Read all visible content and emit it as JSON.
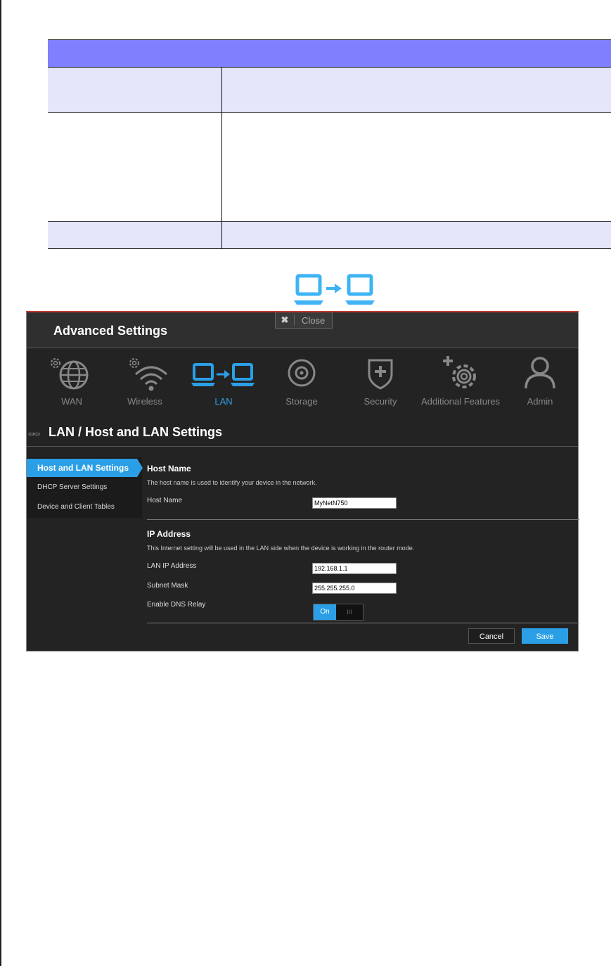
{
  "app": {
    "title": "Advanced Settings",
    "close_label": "Close",
    "close_x": "✖"
  },
  "nav": {
    "items": [
      {
        "label": "WAN",
        "icon": "globe-gear-icon"
      },
      {
        "label": "Wireless",
        "icon": "wifi-gear-icon"
      },
      {
        "label": "LAN",
        "icon": "lan-computers-icon",
        "active": true
      },
      {
        "label": "Storage",
        "icon": "storage-disc-icon"
      },
      {
        "label": "Security",
        "icon": "shield-icon"
      },
      {
        "label": "Additional Features",
        "icon": "add-gear-icon"
      },
      {
        "label": "Admin",
        "icon": "user-icon"
      }
    ]
  },
  "page": {
    "title": "LAN / Host and LAN Settings",
    "title_icon": "▭▭"
  },
  "sidebar": {
    "items": [
      {
        "label": "Host and LAN Settings",
        "active": true
      },
      {
        "label": "DHCP Server Settings"
      },
      {
        "label": "Device and Client Tables"
      }
    ]
  },
  "host_name": {
    "title": "Host Name",
    "desc": "The host name is used to identify your device in the network.",
    "label": "Host Name",
    "value": "MyNetN750"
  },
  "ip_address": {
    "title": "IP Address",
    "desc": "This Internet setting will be used in the LAN side when the device is working in the router mode.",
    "lan_ip_label": "LAN IP Address",
    "lan_ip_value": "192.168.1.1",
    "subnet_label": "Subnet Mask",
    "subnet_value": "255.255.255.0",
    "dns_relay_label": "Enable DNS Relay",
    "dns_relay_on": "On",
    "dns_relay_off": "III"
  },
  "actions": {
    "cancel": "Cancel",
    "save": "Save"
  },
  "colors": {
    "accent": "#2b9fe6",
    "table_header": "#8080ff",
    "table_row": "#e6e6fa"
  }
}
